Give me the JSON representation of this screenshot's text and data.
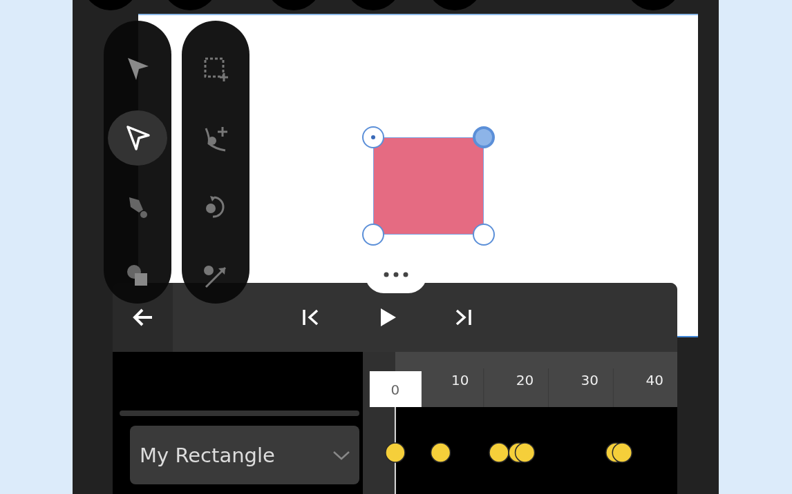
{
  "tool_palettes": [
    {
      "tools": [
        {
          "kind": "select-filled",
          "selected": false
        },
        {
          "kind": "select-outline",
          "selected": true
        },
        {
          "kind": "pen",
          "selected": false
        },
        {
          "kind": "shapes",
          "selected": false
        }
      ]
    },
    {
      "tools": [
        {
          "kind": "crop-add",
          "selected": false
        },
        {
          "kind": "node-add",
          "selected": false
        },
        {
          "kind": "rotate",
          "selected": false
        },
        {
          "kind": "path",
          "selected": false
        }
      ]
    }
  ],
  "canvas": {
    "shape": {
      "kind": "rectangle",
      "color": "#e56b82",
      "handles": [
        {
          "origin": true,
          "selected": false
        },
        {
          "origin": false,
          "selected": true
        },
        {
          "origin": false,
          "selected": false
        },
        {
          "origin": false,
          "selected": false
        }
      ]
    }
  },
  "timeline": {
    "controls": [
      {
        "kind": "back"
      },
      {
        "kind": "skip-start"
      },
      {
        "kind": "play"
      },
      {
        "kind": "skip-end"
      }
    ],
    "layer": {
      "name": "My Rectangle"
    },
    "current_frame": "0",
    "ruler_labels": [
      "10",
      "20",
      "30",
      "40"
    ]
  }
}
